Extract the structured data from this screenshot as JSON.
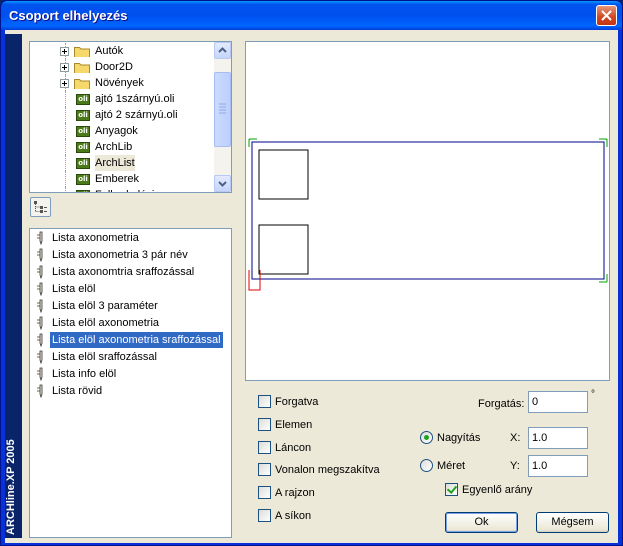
{
  "window": {
    "title": "Csoport elhelyezés"
  },
  "sidebar": {
    "brand": "ARCHline.XP 2005"
  },
  "tree": {
    "items": [
      {
        "label": "Autók",
        "kind": "folder",
        "expandable": true
      },
      {
        "label": "Door2D",
        "kind": "folder",
        "expandable": true
      },
      {
        "label": "Növények",
        "kind": "folder",
        "expandable": true
      },
      {
        "label": "ajtó 1szárnyú.oli",
        "kind": "oli",
        "expandable": false
      },
      {
        "label": "ajtó 2 szárnyú.oli",
        "kind": "oli",
        "expandable": false
      },
      {
        "label": "Anyagok",
        "kind": "oli",
        "expandable": false
      },
      {
        "label": "ArchLib",
        "kind": "oli",
        "expandable": false
      },
      {
        "label": "ArchList",
        "kind": "oli",
        "expandable": false,
        "highlighted": true
      },
      {
        "label": "Emberek",
        "kind": "oli",
        "expandable": false
      },
      {
        "label": "Falburkolási",
        "kind": "oli",
        "expandable": false
      }
    ],
    "oli_icon_text": "oli"
  },
  "list": {
    "items": [
      "Lista axonometria",
      "Lista axonometria 3 pár név",
      "Lista axonomtria sraffozással",
      "Lista elöl",
      "Lista elöl 3 paraméter",
      "Lista elöl axonometria",
      "Lista elöl axonometria sraffozással",
      "Lista elöl sraffozással",
      "Lista info elöl",
      "Lista rövid"
    ],
    "selected_index": 6
  },
  "options": {
    "forgatva": {
      "label": "Forgatva",
      "checked": false
    },
    "elemen": {
      "label": "Elemen",
      "checked": false
    },
    "lancon": {
      "label": "Láncon",
      "checked": false
    },
    "vonalon": {
      "label": "Vonalon megszakítva",
      "checked": false
    },
    "a_rajzon": {
      "label": "A rajzon",
      "checked": false
    },
    "a_sikon": {
      "label": "A síkon",
      "checked": false
    }
  },
  "rotation": {
    "label": "Forgatás:",
    "value": "0",
    "unit": "°"
  },
  "scale_mode": {
    "nagyitas": {
      "label": "Nagyítás",
      "selected": true
    },
    "meret": {
      "label": "Méret",
      "selected": false
    }
  },
  "x": {
    "label": "X:",
    "value": "1.0"
  },
  "y": {
    "label": "Y:",
    "value": "1.0"
  },
  "uniform": {
    "label": "Egyenlő arány",
    "checked": true
  },
  "buttons": {
    "ok": "Ok",
    "cancel": "Mégsem"
  },
  "colors": {
    "title_bar": "#0054e3",
    "selection": "#316ac5",
    "preview_frame": "#00008b",
    "handle_green": "#00a000",
    "handle_red": "#e00000"
  }
}
